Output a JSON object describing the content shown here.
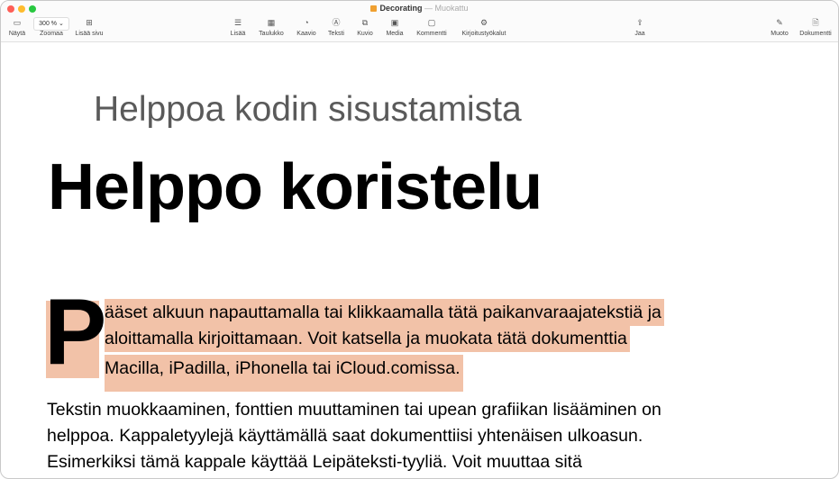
{
  "window": {
    "title": "Decorating",
    "status": "— Muokattu"
  },
  "toolbar": {
    "view": "Näytä",
    "zoom_value": "300 %",
    "zoom": "Zoomaa",
    "add_page": "Lisää sivu",
    "insert": "Lisää",
    "table": "Taulukko",
    "chart": "Kaavio",
    "text": "Teksti",
    "shape": "Kuvio",
    "media": "Media",
    "comment": "Kommentti",
    "writing_tools": "Kirjoitustyökalut",
    "share": "Jaa",
    "format": "Muoto",
    "document": "Dokumentti"
  },
  "document": {
    "subtitle": "Helppoa kodin sisustamista",
    "heading": "Helppo koristelu",
    "drop_cap": "P",
    "placeholder_lines": [
      "ääset alkuun napauttamalla tai klikkaamalla tätä paikanvaraajatekstiä ja",
      "aloittamalla kirjoittamaan. Voit katsella ja muokata tätä dokumenttia",
      "Macilla, iPadilla, iPhonella tai iCloud.comissa."
    ],
    "body_lines": [
      "Tekstin muokkaaminen, fonttien muuttaminen tai upean grafiikan lisääminen on",
      "helppoa. Kappaletyylejä käyttämällä saat dokumenttiisi yhtenäisen ulkoasun.",
      "Esimerkiksi tämä kappale käyttää Leipäteksti-tyyliä. Voit muuttaa sitä"
    ]
  },
  "colors": {
    "highlight": "#f2c2a8",
    "close": "#fe5f57",
    "minimize": "#febc2e",
    "maximize": "#28c840"
  }
}
